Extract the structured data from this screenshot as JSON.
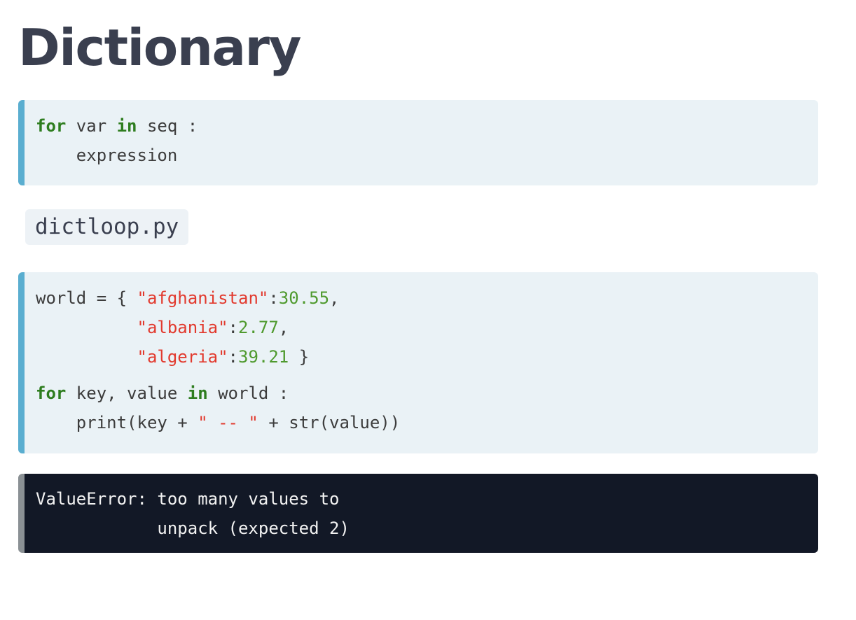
{
  "title": "Dictionary",
  "syntax_block": {
    "kw_for": "for",
    "var": " var ",
    "kw_in": "in",
    "seq": " seq :",
    "body": "    expression"
  },
  "filename": "dictloop.py",
  "code_block": {
    "l1_a": "world = { ",
    "l1_str": "\"afghanistan\"",
    "l1_colon": ":",
    "l1_num": "30.55",
    "l1_end": ",",
    "l2_indent": "          ",
    "l2_str": "\"albania\"",
    "l2_colon": ":",
    "l2_num": "2.77",
    "l2_end": ",",
    "l3_indent": "          ",
    "l3_str": "\"algeria\"",
    "l3_colon": ":",
    "l3_num": "39.21",
    "l3_end": " }",
    "l4_kw_for": "for",
    "l4_mid": " key, value ",
    "l4_kw_in": "in",
    "l4_end": " world :",
    "l5_a": "    print(key + ",
    "l5_str": "\" -- \"",
    "l5_end": " + str(value))"
  },
  "error_block": {
    "line1": "ValueError: too many values to",
    "line2": "            unpack (expected 2)"
  },
  "colors": {
    "keyword": "#2e7d1f",
    "string": "#e23a2e",
    "number": "#4f9a2e",
    "accent_bar": "#5aaed0",
    "error_bg": "#121826"
  }
}
